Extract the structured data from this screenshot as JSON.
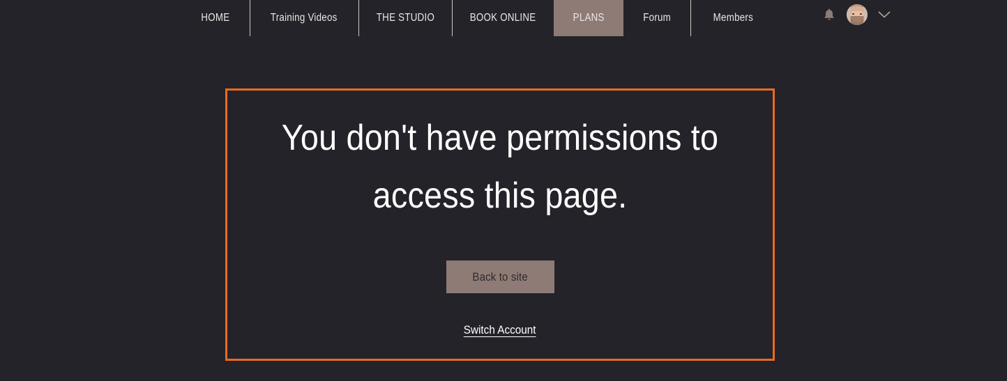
{
  "page": {
    "background_color": "#242329"
  },
  "header": {
    "nav_items": [
      {
        "label": "HOME",
        "selected": false,
        "divider_before": false
      },
      {
        "label": "Training Videos",
        "selected": false,
        "divider_before": true
      },
      {
        "label": "THE STUDIO",
        "selected": false,
        "divider_before": true
      },
      {
        "label": "BOOK ONLINE",
        "selected": false,
        "divider_before": true
      },
      {
        "label": "PLANS",
        "selected": true,
        "divider_before": false
      },
      {
        "label": "Forum",
        "selected": false,
        "divider_before": false
      },
      {
        "label": "Members",
        "selected": false,
        "divider_before": true
      }
    ],
    "selected_tab": "PLANS",
    "selected_tab_color": "#8e7b76",
    "nav_text_color": "#e8e6e6",
    "divider_color": "#cfcbc8",
    "tools": {
      "notifications_icon": "bell-icon",
      "avatar_icon": "user-avatar",
      "account_menu_icon": "chevron-down-icon"
    }
  },
  "main": {
    "panel": {
      "border_color": "#ea6b1f",
      "heading": "You don't have permissions to access this page.",
      "back_button_label": "Back to site",
      "back_button_color": "#8e7b76",
      "switch_account_label": "Switch Account"
    }
  }
}
